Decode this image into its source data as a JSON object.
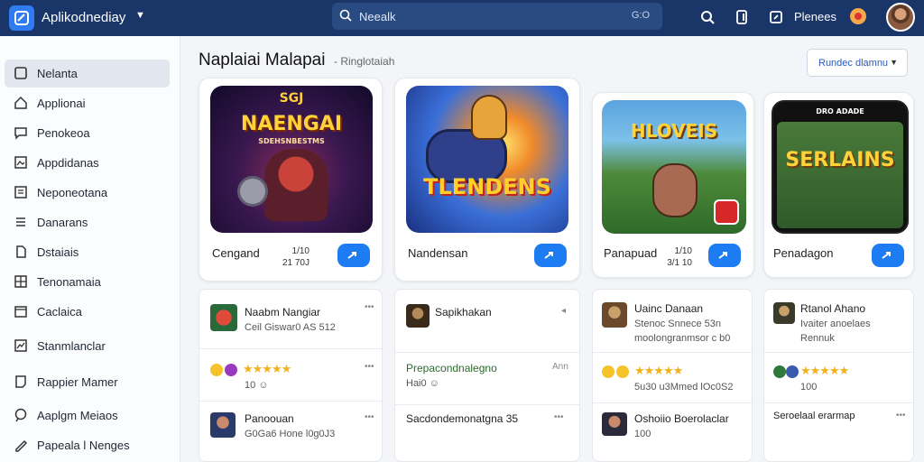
{
  "header": {
    "app_title": "Aplikodnediay",
    "search_placeholder": "Neealk",
    "search_shortcut": "G:O",
    "profile_label": "Plenees"
  },
  "sidebar": {
    "items": [
      {
        "label": "Nelanta",
        "icon": "square-icon"
      },
      {
        "label": "Applionai",
        "icon": "home-icon"
      },
      {
        "label": "Penokeoa",
        "icon": "chat-icon"
      },
      {
        "label": "Appdidanas",
        "icon": "image-icon"
      },
      {
        "label": "Neponeotana",
        "icon": "list-icon"
      },
      {
        "label": "Danarans",
        "icon": "menu-icon"
      },
      {
        "label": "Dstaiais",
        "icon": "document-icon"
      },
      {
        "label": "Tenonamaia",
        "icon": "grid-icon"
      },
      {
        "label": "Caclaica",
        "icon": "calendar-icon"
      },
      {
        "label": "Stanmlanclar",
        "icon": "chart-icon"
      },
      {
        "label": "Rappier Mamer",
        "icon": "note-icon"
      },
      {
        "label": "Aaplgm Meiaos",
        "icon": "comment-icon"
      },
      {
        "label": "Papeala l Nenges",
        "icon": "pen-icon"
      }
    ]
  },
  "main": {
    "title": "Naplaiai Malapai",
    "subtitle": "- Ringlotaiah",
    "sort_label": "Rundec dlamnu",
    "featured": [
      {
        "name": "Cengand",
        "meta_top": "1/10",
        "meta_bottom": "21 70J",
        "art_text": "NAENGAI",
        "art_top": "SGJ",
        "art_sub": "SDEHSNBESTMS"
      },
      {
        "name": "Nandensan",
        "meta_top": "",
        "meta_bottom": "",
        "art_text": "TLENDENS",
        "art_top": "",
        "art_sub": ""
      },
      {
        "name": "Panapuad",
        "meta_top": "1/10",
        "meta_bottom": "3/1 10",
        "art_text": "HLOVEIS",
        "art_top": "",
        "art_sub": ""
      },
      {
        "name": "Penadagon",
        "meta_top": "",
        "meta_bottom": "",
        "art_text": "SERLAINS",
        "art_top": "DRO ADADE",
        "art_sub": ""
      }
    ],
    "reviews": [
      [
        {
          "name": "Naabm Nangiar",
          "sub": "Ceil Giswar0 AS 512",
          "rating": "",
          "kind": "user"
        },
        {
          "name": "",
          "sub": "10 ☺",
          "rating": "★★★★★",
          "kind": "rating"
        },
        {
          "name": "Panoouan",
          "sub": "G0Ga6 Hone l0g0J3",
          "rating": "",
          "kind": "user"
        }
      ],
      [
        {
          "name": "Sapikhakan",
          "sub": "",
          "rating": "",
          "kind": "user"
        },
        {
          "name": "Prepacondnalegno",
          "sub": "Hai0 ☺",
          "rating": "",
          "kind": "text",
          "right": "Ann"
        },
        {
          "name": "Sacdondemonatgna 35",
          "sub": "",
          "rating": "",
          "kind": "text"
        }
      ],
      [
        {
          "name": "Uainc Danaan",
          "sub": "Stenoc Snnece 53n",
          "sub2": "moolongranmsor c b0",
          "rating": "",
          "kind": "user"
        },
        {
          "name": "",
          "sub": "5u30 u3Mmed lOc0S2",
          "rating": "★★★★★",
          "kind": "rating"
        },
        {
          "name": "Oshoiio Boerolaclar",
          "sub": "100",
          "rating": "",
          "kind": "user"
        }
      ],
      [
        {
          "name": "Rtanol Ahano",
          "sub": "Ivaiter anoelaes",
          "sub2": "Rennuk",
          "rating": "",
          "kind": "user"
        },
        {
          "name": "",
          "sub": "100",
          "rating": "★★★★★",
          "kind": "rating"
        },
        {
          "name": "Seroelaal erarmap",
          "sub": "",
          "rating": "",
          "kind": "text"
        }
      ]
    ]
  },
  "colors": {
    "topbar": "#1a3567",
    "accent": "#1d7cf2",
    "star": "#f2b21c"
  }
}
